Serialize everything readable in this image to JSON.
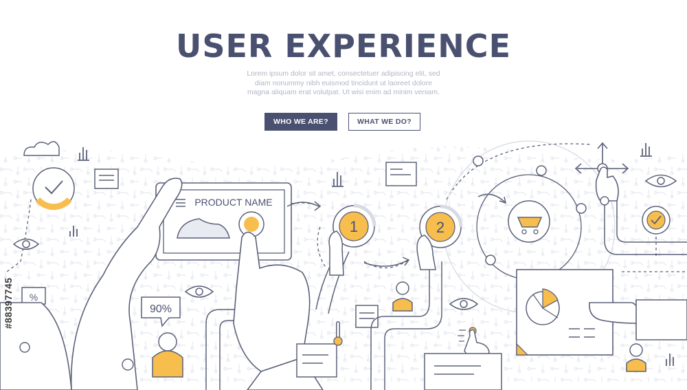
{
  "header": {
    "title": "USER EXPERIENCE",
    "subtitle_lines": [
      "Lorem ipsum dolor sit amet, consectetuer adipiscing elit, sed",
      "diam nonummy nibh euismod tincidunt ut laoreet dolore",
      "magna aliquam erat volutpat. Ut wisi enim ad minim veniam."
    ]
  },
  "buttons": {
    "primary_label": "WHO WE ARE?",
    "secondary_label": "WHAT WE DO?"
  },
  "illustration": {
    "tablet_label": "PRODUCT NAME",
    "step_one": "1",
    "step_two": "2",
    "percent_badge": "90%",
    "percent_sign": "%",
    "watermark_id": "#88397745"
  },
  "colors": {
    "ink": "#4a5170",
    "accent": "#f7be4d",
    "line": "#5a6078",
    "pattern": "#e9ebf2",
    "muted": "#b3b6c6"
  },
  "icons": [
    "cloud-icon",
    "check-icon",
    "bar-chart-icon",
    "eye-icon",
    "cart-icon",
    "move-arrows-icon",
    "pie-chart-icon",
    "user-icon",
    "shoe-icon",
    "thermometer-icon",
    "percent-icon",
    "document-icon"
  ]
}
